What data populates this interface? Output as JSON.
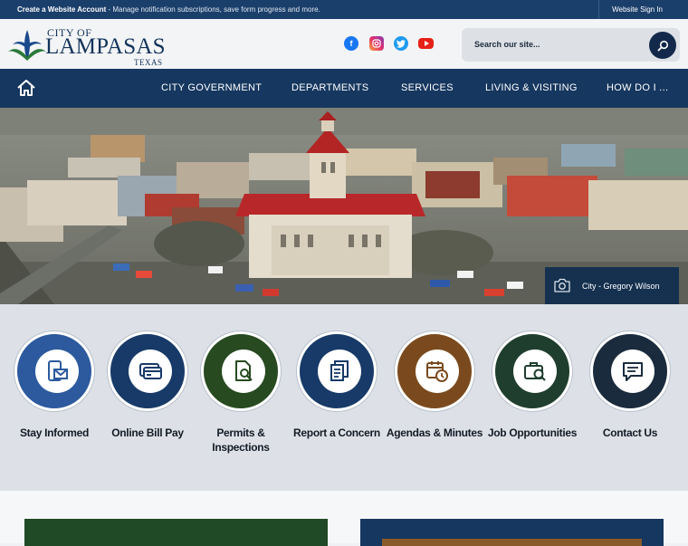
{
  "topbar": {
    "create_account": "Create a Website Account",
    "tagline": " - Manage notification subscriptions, save form progress and more.",
    "sign_in": "Website Sign In"
  },
  "logo": {
    "city_of": "CITY OF",
    "name": "LAMPASAS",
    "state": "TEXAS"
  },
  "social": {
    "facebook": "facebook-icon",
    "instagram": "instagram-icon",
    "twitter": "twitter-icon",
    "youtube": "youtube-icon"
  },
  "search": {
    "placeholder": "Search our site..."
  },
  "nav": {
    "items": [
      "CITY GOVERNMENT",
      "DEPARTMENTS",
      "SERVICES",
      "LIVING & VISITING",
      "HOW DO I ..."
    ]
  },
  "hero": {
    "credit": "City - Gregory Wilson"
  },
  "quick_links": [
    {
      "label": "Stay Informed",
      "color": "#2d5a9e",
      "icon": "mail-device-icon"
    },
    {
      "label": "Online Bill Pay",
      "color": "#173a68",
      "icon": "credit-card-icon"
    },
    {
      "label": "Permits & Inspections",
      "color": "#274a20",
      "icon": "document-search-icon"
    },
    {
      "label": "Report a Concern",
      "color": "#173a68",
      "icon": "documents-icon"
    },
    {
      "label": "Agendas & Minutes",
      "color": "#7a4a1e",
      "icon": "calendar-clock-icon"
    },
    {
      "label": "Job Opportunities",
      "color": "#1f3e2e",
      "icon": "briefcase-search-icon"
    },
    {
      "label": "Contact Us",
      "color": "#1a2b3d",
      "icon": "chat-icon"
    }
  ],
  "colors": {
    "navy": "#16375f",
    "topbar": "#1b3f6b",
    "green": "#1f4a25"
  }
}
